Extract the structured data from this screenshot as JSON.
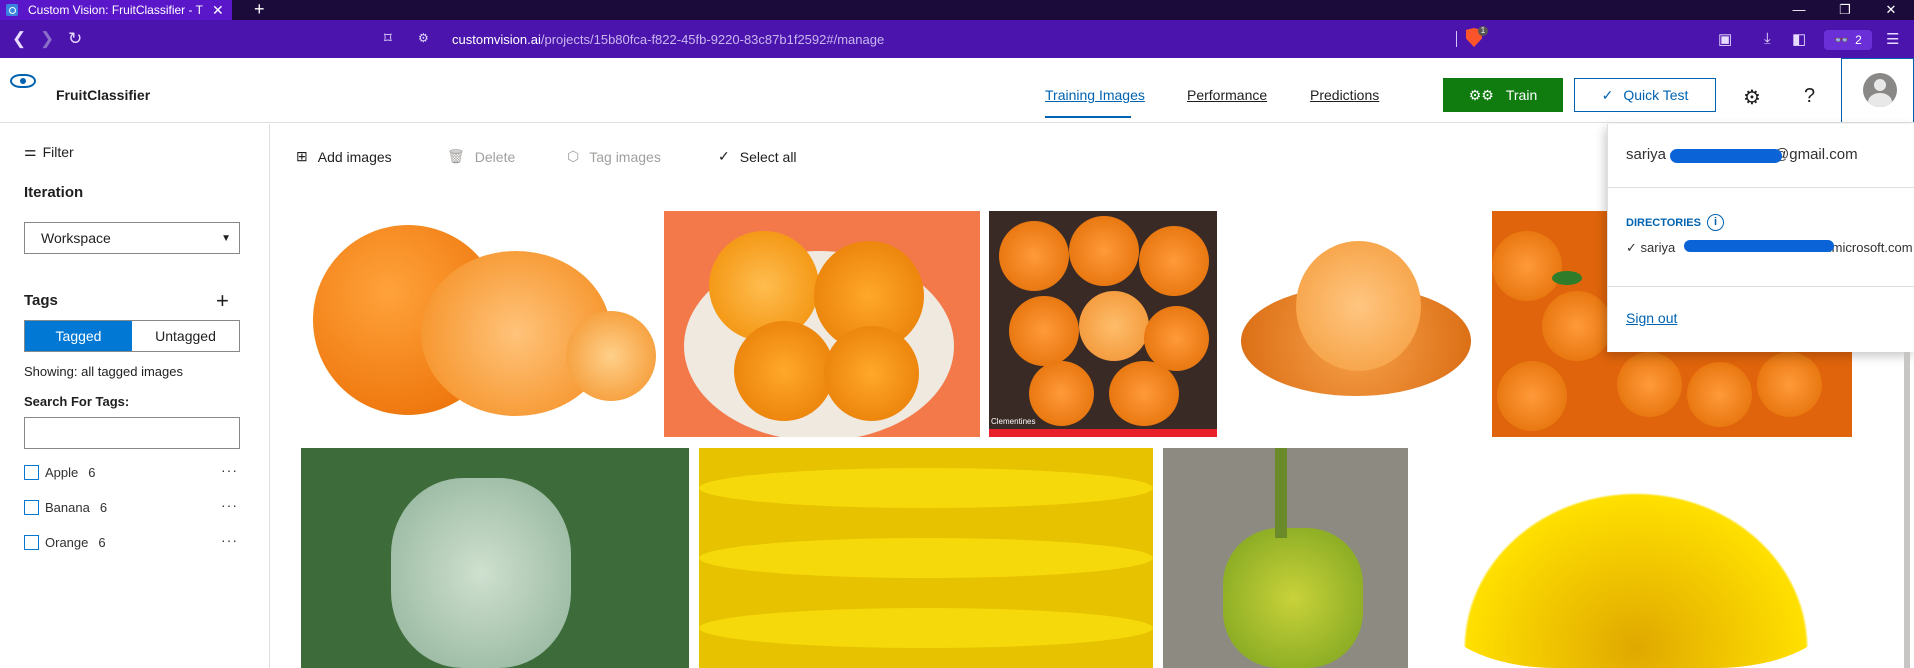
{
  "browser": {
    "tab_title": "Custom Vision: FruitClassifier - T",
    "url_host": "customvision.ai",
    "url_path": "/projects/15b80fca-f822-45fb-9220-83c87b1f2592#/manage",
    "brave_badge": "1",
    "extension_count": "2"
  },
  "app": {
    "project_name": "FruitClassifier",
    "nav": {
      "training_images": "Training Images",
      "performance": "Performance",
      "predictions": "Predictions"
    },
    "train_label": "Train",
    "quick_test_label": "Quick Test"
  },
  "left_panel": {
    "filter_label": "Filter",
    "iteration_label": "Iteration",
    "iteration_value": "Workspace",
    "tags_label": "Tags",
    "tagged_label": "Tagged",
    "untagged_label": "Untagged",
    "showing_text": "Showing: all tagged images",
    "search_label": "Search For Tags:",
    "search_value": "",
    "tags": [
      {
        "name": "Apple",
        "count": "6"
      },
      {
        "name": "Banana",
        "count": "6"
      },
      {
        "name": "Orange",
        "count": "6"
      }
    ]
  },
  "toolbar": {
    "add_images": "Add images",
    "delete": "Delete",
    "tag_images": "Tag images",
    "select_all": "Select all"
  },
  "images": {
    "clementines_caption": "Clementines"
  },
  "account_menu": {
    "email_prefix": "sariya",
    "email_suffix": "@gmail.com",
    "directories_label": "DIRECTORIES",
    "directory_prefix": "sariya",
    "directory_suffix": "onmicrosoft.com",
    "sign_out": "Sign out"
  },
  "colors": {
    "brand_blue": "#0063b1",
    "train_green": "#107c10",
    "browser_purple": "#4b14ad"
  }
}
